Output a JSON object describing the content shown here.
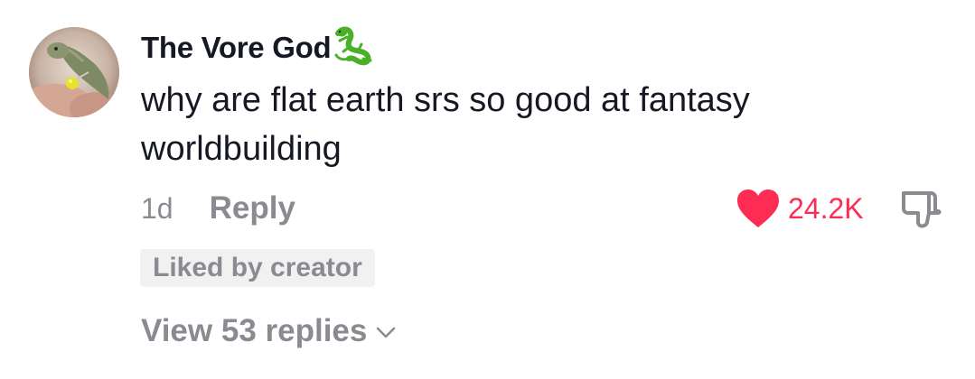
{
  "comment": {
    "username": "The Vore God",
    "username_emoji": "lizard-icon",
    "text": "why are flat earth srs so good at fantasy worldbuilding",
    "timestamp": "1d",
    "reply_label": "Reply",
    "like_count": "24.2K",
    "liked": true,
    "badge": "Liked by creator",
    "view_replies_label": "View 53 replies"
  },
  "colors": {
    "text_primary": "#161823",
    "text_secondary": "#8a8b91",
    "like_accent": "#fe2c55",
    "badge_bg": "#f1f1f2"
  },
  "icons": [
    "avatar",
    "lizard-icon",
    "heart-icon",
    "dislike-icon",
    "chevron-down-icon"
  ]
}
